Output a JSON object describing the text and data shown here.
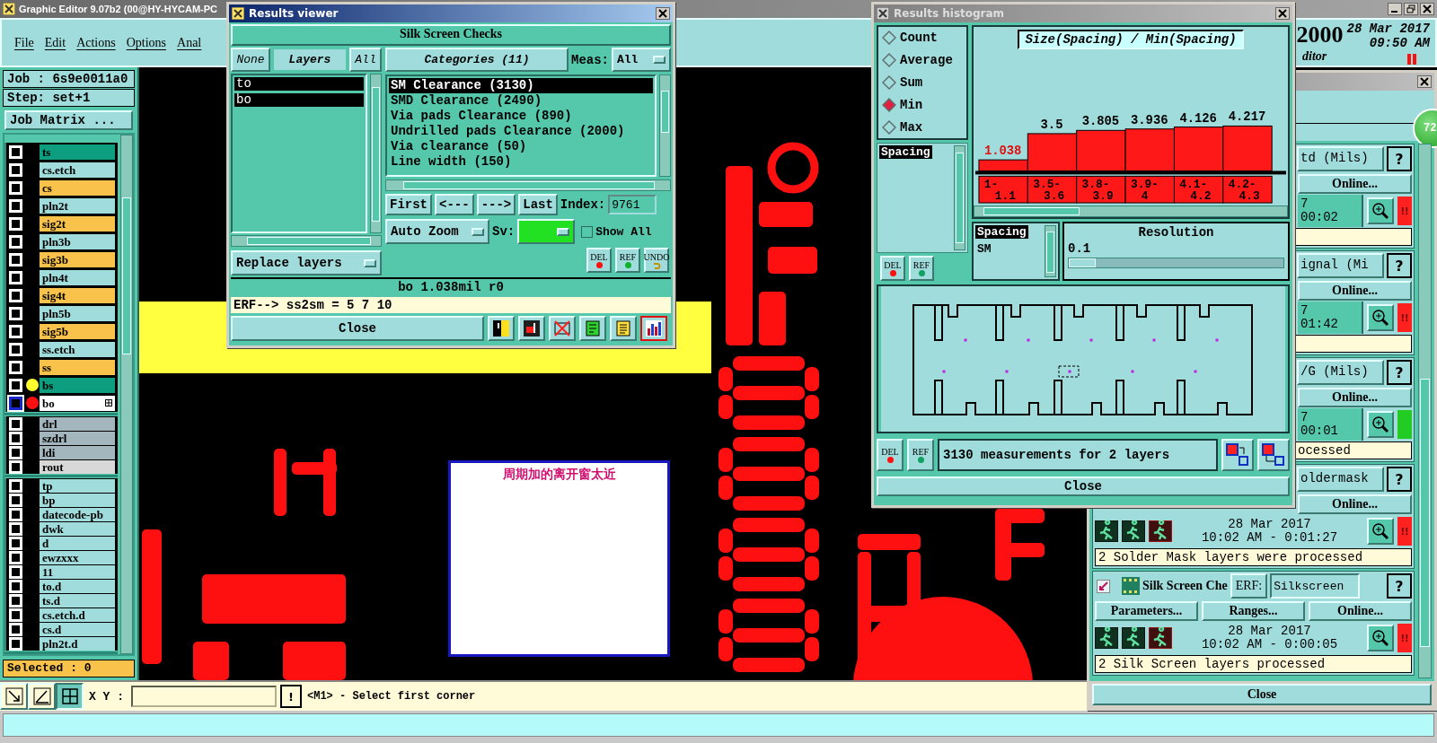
{
  "main_window": {
    "title": "Graphic Editor 9.07b2 (00@HY-HYCAM-PC"
  },
  "menu": [
    "File",
    "Edit",
    "Actions",
    "Options",
    "Anal"
  ],
  "header": {
    "counter": "2000",
    "date": "28 Mar 2017",
    "time": "09:50 AM",
    "subtitle": "ditor"
  },
  "job": {
    "job": "Job : 6s9e0011a0",
    "step": "Step: set+1",
    "matrix_button": "Job Matrix ..."
  },
  "layer_groups": [
    {
      "layers": [
        {
          "name": "ts",
          "color": "#0d9e80",
          "selected": false
        },
        {
          "name": "cs.etch",
          "color": "#a0dcdc",
          "selected": false
        },
        {
          "name": "cs",
          "color": "#f9c24b",
          "selected": false
        },
        {
          "name": "pln2t",
          "color": "#a0dcdc",
          "selected": false
        },
        {
          "name": "sig2t",
          "color": "#f9c24b",
          "selected": false
        },
        {
          "name": "pln3b",
          "color": "#a0dcdc",
          "selected": false
        },
        {
          "name": "sig3b",
          "color": "#f9c24b",
          "selected": false
        },
        {
          "name": "pln4t",
          "color": "#a0dcdc",
          "selected": false
        },
        {
          "name": "sig4t",
          "color": "#f9c24b",
          "selected": false
        },
        {
          "name": "pln5b",
          "color": "#a0dcdc",
          "selected": false
        },
        {
          "name": "sig5b",
          "color": "#f9c24b",
          "selected": false
        },
        {
          "name": "ss.etch",
          "color": "#a0dcdc",
          "selected": false
        },
        {
          "name": "ss",
          "color": "#f9c24b",
          "selected": false
        },
        {
          "name": "bs",
          "color": "#0d9e80",
          "dot": {
            "color": "#ffff30"
          },
          "selected": false
        },
        {
          "name": "bo",
          "color": "#ffffff",
          "dot": {
            "color": "#ff1010"
          },
          "selected": true
        }
      ]
    },
    {
      "layers": [
        {
          "name": "drl",
          "color": "#a3b6be",
          "selected": false
        },
        {
          "name": "szdrl",
          "color": "#a3b6be",
          "selected": false
        },
        {
          "name": "ldi",
          "color": "#a3b6be",
          "selected": false
        },
        {
          "name": "rout",
          "color": "#d8d8d8",
          "selected": false
        }
      ]
    },
    {
      "layers": [
        {
          "name": "tp",
          "color": "#a0dcdc",
          "selected": false
        },
        {
          "name": "bp",
          "color": "#a0dcdc",
          "selected": false
        },
        {
          "name": "datecode-pb",
          "color": "#a0dcdc",
          "selected": false
        },
        {
          "name": "dwk",
          "color": "#a0dcdc",
          "selected": false
        },
        {
          "name": "d",
          "color": "#a0dcdc",
          "selected": false
        },
        {
          "name": "ewzxxx",
          "color": "#a0dcdc",
          "selected": false
        },
        {
          "name": "11",
          "color": "#a0dcdc",
          "selected": false
        },
        {
          "name": "to.d",
          "color": "#a0dcdc",
          "selected": false
        },
        {
          "name": "ts.d",
          "color": "#a0dcdc",
          "selected": false
        },
        {
          "name": "cs.etch.d",
          "color": "#a0dcdc",
          "selected": false
        },
        {
          "name": "cs.d",
          "color": "#a0dcdc",
          "selected": false
        },
        {
          "name": "pln2t.d",
          "color": "#a0dcdc",
          "selected": false
        }
      ]
    }
  ],
  "selected_count": "Selected : 0",
  "canvas": {
    "note": "周期加的离开窗太近"
  },
  "toolbar": {
    "xy_label": "X Y :",
    "alert_button": "!",
    "prompt": "<M1> - Select first corner"
  },
  "results_viewer": {
    "title": "Results viewer",
    "heading": "Silk Screen Checks",
    "layer_buttons": [
      "None",
      "Layers",
      "All"
    ],
    "layers": [
      {
        "name": "to",
        "selected": true
      },
      {
        "name": "bo",
        "selected": true
      }
    ],
    "layer_mode": "Replace layers",
    "categories_button": "Categories (11)",
    "meas_label": "Meas:",
    "meas_value": "All",
    "categories": [
      {
        "name": "SM Clearance (3130)",
        "selected": true
      },
      {
        "name": "SMD Clearance (2490)",
        "selected": false
      },
      {
        "name": "Via pads Clearance (890)",
        "selected": false
      },
      {
        "name": "Undrilled pads Clearance (2000)",
        "selected": false
      },
      {
        "name": "Via clearance (50)",
        "selected": false
      },
      {
        "name": "Line width (150)",
        "selected": false
      }
    ],
    "nav": [
      "First",
      "<---",
      "--->",
      "Last"
    ],
    "index_label": "Index:",
    "index_value": "9761",
    "zoom_mode": "Auto Zoom",
    "sv_label": "Sv:",
    "show_all": {
      "label": "Show All",
      "checked": false
    },
    "action_buttons": [
      "DEL",
      "REF",
      "UNDO"
    ],
    "measurement": "bo 1.038mil  r0",
    "erf": "ERF--> ss2sm = 5 7 10",
    "close": "Close"
  },
  "histogram": {
    "title": "Results histogram",
    "modes": [
      {
        "label": "Count",
        "selected": false
      },
      {
        "label": "Average",
        "selected": false
      },
      {
        "label": "Sum",
        "selected": false
      },
      {
        "label": "Min",
        "selected": true
      },
      {
        "label": "Max",
        "selected": false
      }
    ],
    "fields": [
      {
        "name": "Spacing",
        "selected": true
      }
    ],
    "field_buttons": [
      "DEL",
      "REF"
    ],
    "chart_data": {
      "type": "bar",
      "title": "Size(Spacing) / Min(Spacing)",
      "categories": [
        "1-1.1",
        "3.5-3.6",
        "3.8-3.9",
        "3.9-4",
        "4.1-4.2",
        "4.2-4.3"
      ],
      "values": [
        1.038,
        3.5,
        3.805,
        3.936,
        4.126,
        4.217
      ],
      "data_labels": true
    },
    "layers": [
      {
        "name": "Spacing",
        "selected": true
      },
      {
        "name": "SM",
        "selected": false
      }
    ],
    "resolution": {
      "label": "Resolution",
      "value": "0.1",
      "level": 0.06
    },
    "bottom_buttons": [
      "DEL",
      "REF"
    ],
    "summary": "3130 measurements for 2 layers",
    "close": "Close"
  },
  "checklist": {
    "badge": "72",
    "close": "Close",
    "checks": [
      {
        "kind": "hidden_left",
        "name": "td (Mils)",
        "help": "?",
        "buttons": [
          "Online..."
        ],
        "date": "7",
        "time": "00:02",
        "status": {
          "color": "#ff2020",
          "mark": "!!"
        }
      },
      {
        "kind": "hidden_left",
        "name": "ignal (Mi",
        "help": "?",
        "buttons": [
          "Online..."
        ],
        "date": "7",
        "time": "01:42",
        "status": {
          "color": "#ff2020",
          "mark": "!!"
        }
      },
      {
        "kind": "hidden_left",
        "name": "/G (Mils)",
        "help": "?",
        "buttons": [
          "Online..."
        ],
        "date": "7",
        "time": "00:01",
        "status": {
          "color": "#22cc22"
        },
        "message": "ocessed"
      },
      {
        "kind": "hidden_top",
        "name": "oldermask",
        "help": "?",
        "buttons": [
          "Online..."
        ],
        "date": "28 Mar 2017",
        "time": "10:02 AM - 0:01:27",
        "status": {
          "color": "#ff2020",
          "mark": "!!"
        },
        "message": "2 Solder Mask layers were processed"
      },
      {
        "kind": "whole",
        "checked": true,
        "name": "Silk Screen Che",
        "erf_label": "ERF:",
        "erf": "Silkscreen",
        "help": "?",
        "buttons": [
          "Parameters...",
          "Ranges...",
          "Online..."
        ],
        "date": "28 Mar 2017",
        "time": "10:02 AM - 0:00:05",
        "status": {
          "color": "#ff2020",
          "mark": "!!"
        },
        "message": "2 Silk Screen layers processed"
      }
    ]
  }
}
